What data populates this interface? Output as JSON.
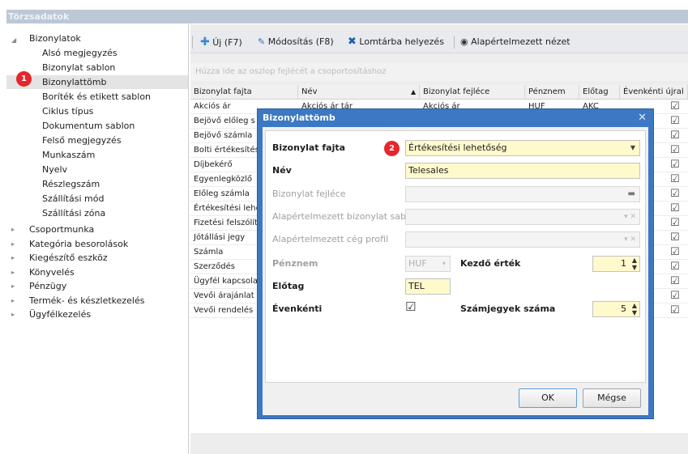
{
  "window": {
    "title": "Törzsadatok"
  },
  "tree": {
    "root_label": "Bizonylatok",
    "children": [
      "Alsó megjegyzés",
      "Bizonylat sablon",
      "Bizonylattömb",
      "Boríték és etikett sablon",
      "Ciklus típus",
      "Dokumentum sablon",
      "Felső megjegyzés",
      "Munkaszám",
      "Nyelv",
      "Részleg­szám",
      "Szállítási mód",
      "Szállítási zóna"
    ],
    "groups": [
      "Csoportmunka",
      "Kategória besorolások",
      "Kiegészítő eszköz",
      "Könyvelés",
      "Pénzügy",
      "Termék- és készletkezelés",
      "Ügyfélkezelés"
    ],
    "selected_badge": "1"
  },
  "toolbar": {
    "new_label": "Új (F7)",
    "edit_label": "Módosítás (F8)",
    "trash_label": "Lomtárba helyezés",
    "default_view_label": "Alapértelmezett nézet"
  },
  "grid": {
    "group_hint": "Húzza ide az oszlop fejlécét a csoportosításhoz",
    "columns": [
      "Bizonylat fajta",
      "Név",
      "Bizonylat fejléce",
      "Pénznem",
      "Előtag",
      "Évenkénti újral"
    ],
    "rows": [
      "Akciós ár",
      "Bejövő előleg s",
      "Bejövő számla",
      "Bolti értékesítés",
      "Díjbekérő",
      "Egyenlegközlő",
      "Előleg számla",
      "Értékesítési lehe",
      "Fizetési felszólít",
      "Jótállási jegy",
      "Számla",
      "Szerződés",
      "Ügyfél kapcsola",
      "Vevői árajánlat",
      "Vevői rendelés"
    ],
    "first_row_extra": {
      "nev": "Akciós ár tár",
      "fejlec": "Akciós ár",
      "penznem": "HUF",
      "elotag": "AKC"
    }
  },
  "dialog": {
    "title": "Bizonylattömb",
    "badge": "2",
    "fields": {
      "fajta_label": "Bizonylat fajta",
      "fajta_value": "Értékesítési lehetőség",
      "nev_label": "Név",
      "nev_value": "Telesales",
      "fejlec_label": "Bizonylat fejléce",
      "sablon_label": "Alapértelmezett bizonylat sablon",
      "ceg_label": "Alapértelmezett cég profil",
      "penznem_label": "Pénznem",
      "penznem_value": "HUF",
      "kezdo_label": "Kezdő érték",
      "kezdo_value": "1",
      "elotag_label": "Előtag",
      "elotag_value": "TEL",
      "evenkenti_label": "Évenkénti",
      "szamjegy_label": "Számjegyek száma",
      "szamjegy_value": "5"
    },
    "ok_label": "OK",
    "cancel_label": "Mégse"
  }
}
